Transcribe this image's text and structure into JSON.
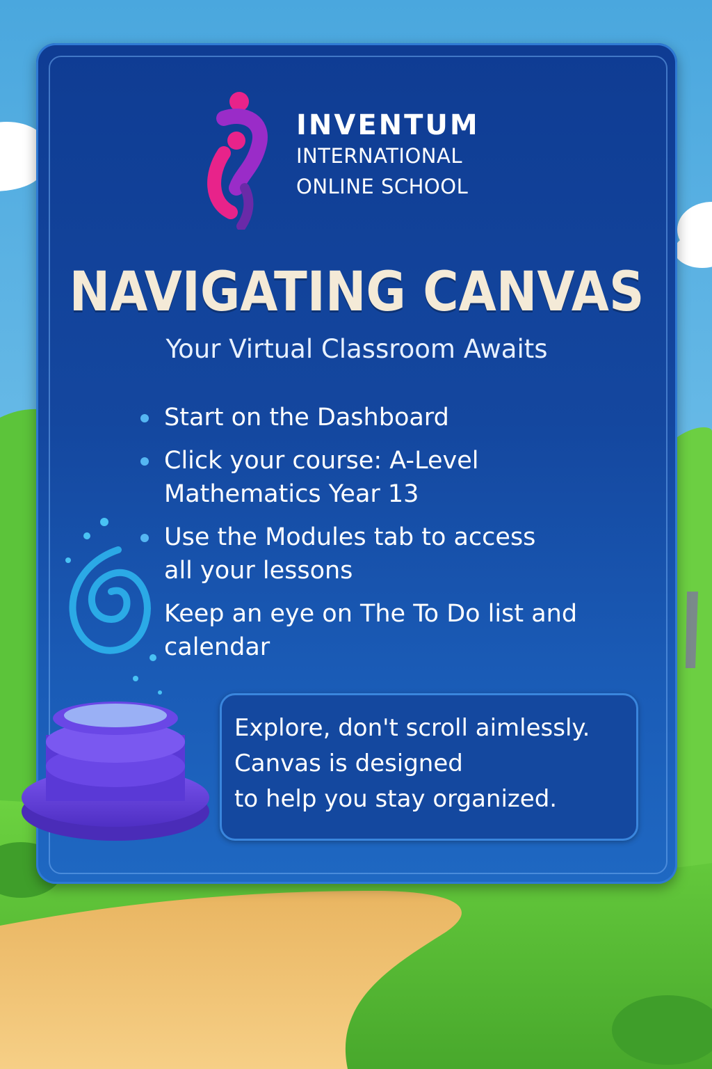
{
  "logo": {
    "name_line1": "INVENTUM",
    "name_line2": "INTERNATIONAL",
    "name_line3": "ONLINE SCHOOL"
  },
  "title": "NAVIGATING CANVAS",
  "subtitle": "Your Virtual Classroom Awaits",
  "bullets": [
    {
      "line1": "Start on the Dashboard",
      "line2": ""
    },
    {
      "line1": "Click your course: A-Level",
      "line2": "Mathematics Year 13"
    },
    {
      "line1": "Use the Modules tab to access",
      "line2": "all your lessons"
    },
    {
      "line1": "Keep an eye on The To Do list and",
      "line2": "calendar"
    }
  ],
  "tip": {
    "line1": "Explore, don't scroll aimlessly.",
    "line2": "Canvas is designed",
    "line3": "to help you stay organized."
  },
  "colors": {
    "sky": "#4fb0e3",
    "panel": "#14479f",
    "title_text": "#f4ead7",
    "bullet_dot": "#55b6f2",
    "logo_pink": "#e8238a",
    "logo_purple": "#7a2fc0",
    "podium": "#6a45e0",
    "grass": "#5cc43a",
    "path": "#f0c06e"
  }
}
